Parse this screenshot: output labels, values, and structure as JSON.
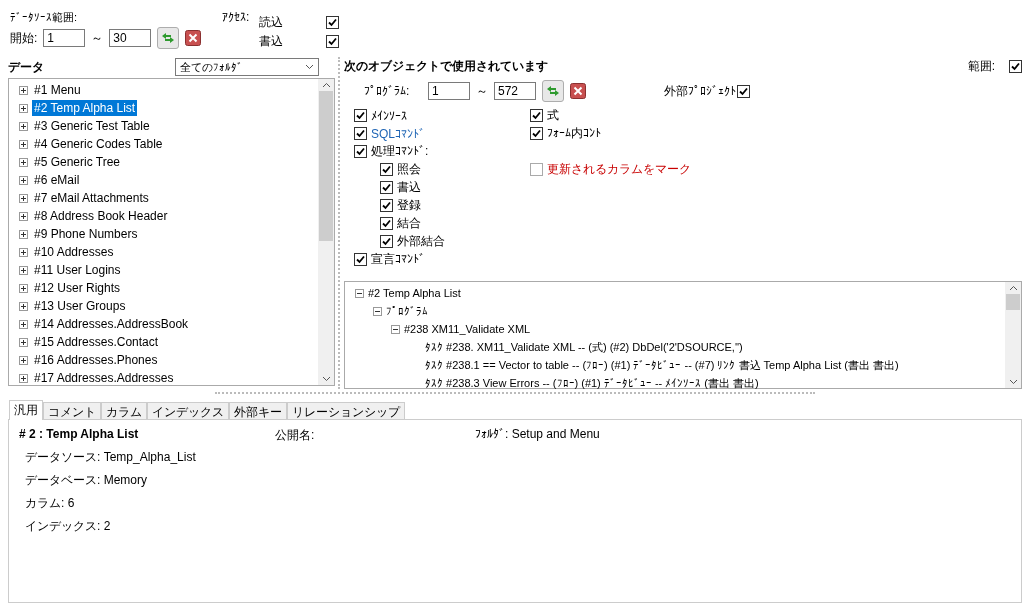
{
  "data_source_range": {
    "label": "ﾃﾞｰﾀｿｰｽ範囲:",
    "start_label": "開始:",
    "from": "1",
    "separator": "～",
    "to": "30"
  },
  "access": {
    "label": "ｱｸｾｽ:",
    "options": [
      {
        "label": "読込",
        "checked": true
      },
      {
        "label": "書込",
        "checked": true
      }
    ]
  },
  "data_panel": {
    "title": "データ",
    "folder_filter": "全てのﾌｫﾙﾀﾞ",
    "items": [
      {
        "label": "#1 Menu",
        "selected": false,
        "expanded": false
      },
      {
        "label": "#2 Temp Alpha List",
        "selected": true,
        "expanded": false
      },
      {
        "label": "#3 Generic Test Table",
        "selected": false,
        "expanded": false
      },
      {
        "label": "#4 Generic Codes Table",
        "selected": false,
        "expanded": false
      },
      {
        "label": "#5 Generic Tree",
        "selected": false,
        "expanded": false
      },
      {
        "label": "#6 eMail",
        "selected": false,
        "expanded": false
      },
      {
        "label": "#7 eMail Attachments",
        "selected": false,
        "expanded": false
      },
      {
        "label": "#8 Address Book Header",
        "selected": false,
        "expanded": false
      },
      {
        "label": "#9 Phone Numbers",
        "selected": false,
        "expanded": false
      },
      {
        "label": "#10 Addresses",
        "selected": false,
        "expanded": false
      },
      {
        "label": "#11 User Logins",
        "selected": false,
        "expanded": false
      },
      {
        "label": "#12 User Rights",
        "selected": false,
        "expanded": false
      },
      {
        "label": "#13 User Groups",
        "selected": false,
        "expanded": false
      },
      {
        "label": "#14 Addresses.AddressBook",
        "selected": false,
        "expanded": false
      },
      {
        "label": "#15 Addresses.Contact",
        "selected": false,
        "expanded": false
      },
      {
        "label": "#16 Addresses.Phones",
        "selected": false,
        "expanded": false
      },
      {
        "label": "#17 Addresses.Addresses",
        "selected": false,
        "expanded": false
      }
    ]
  },
  "usage_panel": {
    "title": "次のオブジェクトで使用されています",
    "range_label": "範囲:",
    "range_checked": true,
    "program_label": "ﾌﾟﾛｸﾞﾗﾑ:",
    "from": "1",
    "separator": "～",
    "to": "572",
    "external_project": {
      "label": "外部ﾌﾟﾛｼﾞｪｸﾄ",
      "checked": true
    },
    "options_left": [
      {
        "label": "ﾒｲﾝｿｰｽ",
        "checked": true
      },
      {
        "label": "SQLｺﾏﾝﾄﾞ",
        "checked": true,
        "color": "#1e64b4"
      },
      {
        "label": "処理ｺﾏﾝﾄﾞ:",
        "checked": true,
        "children": [
          {
            "label": "照会",
            "checked": true
          },
          {
            "label": "書込",
            "checked": true
          },
          {
            "label": "登録",
            "checked": true
          },
          {
            "label": "結合",
            "checked": true
          },
          {
            "label": "外部結合",
            "checked": true
          }
        ]
      },
      {
        "label": "宣言ｺﾏﾝﾄﾞ",
        "checked": true
      }
    ],
    "options_right": [
      {
        "label": "式",
        "checked": true
      },
      {
        "label": "ﾌｫｰﾑ内ｺﾝﾄ",
        "checked": true
      },
      {
        "label": "更新されるカラムをマーク",
        "checked": false,
        "color": "#c80000"
      }
    ],
    "tree": [
      {
        "label": "#2 Temp Alpha List",
        "expanded": true,
        "children": [
          {
            "label": "ﾌﾟﾛｸﾞﾗﾑ",
            "expanded": true,
            "children": [
              {
                "label": "#238 XM11_Validate XML",
                "expanded": true,
                "children": [
                  {
                    "label": "ﾀｽｸ #238.  XM11_Validate XML -- (式) (#2) DbDel('2'DSOURCE,'')"
                  },
                  {
                    "label": "ﾀｽｸ #238.1  == Vector to table -- (ﾌﾛｰ) (#1) ﾃﾞｰﾀﾋﾞｭｰ -- (#7) ﾘﾝｸ 書込 Temp Alpha List (書出 書出)"
                  },
                  {
                    "label": "ﾀｽｸ #238.3  View Errors -- (ﾌﾛｰ) (#1) ﾃﾞｰﾀﾋﾞｭｰ -- ﾒｲﾝｿｰｽ (書出 書出)"
                  }
                ]
              }
            ]
          }
        ]
      }
    ]
  },
  "tabs": [
    {
      "label": "汎用",
      "selected": true
    },
    {
      "label": "コメント",
      "selected": false
    },
    {
      "label": "カラム",
      "selected": false
    },
    {
      "label": "インデックス",
      "selected": false
    },
    {
      "label": "外部キー",
      "selected": false
    },
    {
      "label": "リレーションシップ",
      "selected": false
    }
  ],
  "details": {
    "title": "# 2 : Temp Alpha List",
    "public_name_label": "公開名:",
    "folder": "ﾌｫﾙﾀﾞ: Setup and Menu",
    "fields": [
      "データソース: Temp_Alpha_List",
      "データベース: Memory",
      "カラム: 6",
      "インデックス: 2"
    ]
  }
}
